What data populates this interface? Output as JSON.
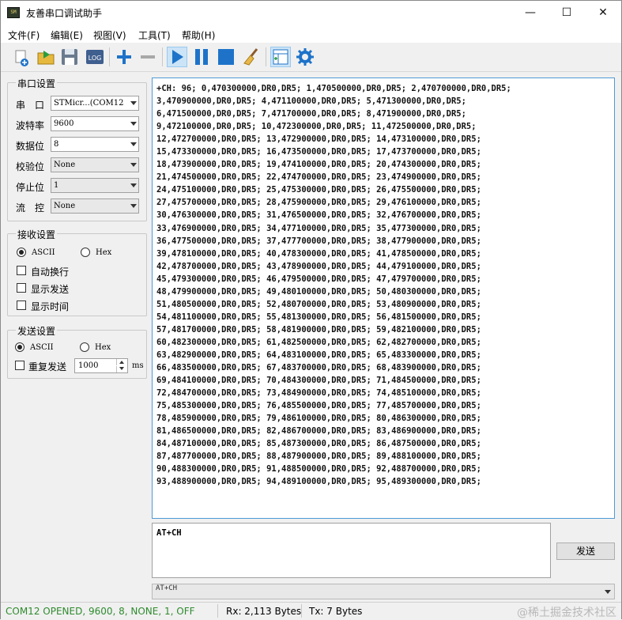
{
  "window": {
    "icon_text": "SM",
    "title": "友善串口调试助手",
    "minimize_glyph": "—",
    "maximize_glyph": "☐",
    "close_glyph": "✕"
  },
  "menu": [
    "文件(F)",
    "编辑(E)",
    "视图(V)",
    "工具(T)",
    "帮助(H)"
  ],
  "toolbar": {
    "log_label": "LOG",
    "icons": [
      "new-icon",
      "open-icon",
      "save-icon",
      "log-icon",
      "add-icon",
      "remove-icon",
      "play-icon",
      "pause-icon",
      "stop-icon",
      "broom-icon",
      "layout-icon",
      "gear-icon"
    ],
    "accent": "#1e73c9"
  },
  "serial_settings": {
    "title": "串口设置",
    "port_label": "串　口",
    "port_value": "STMicr...(COM12",
    "baud_label": "波特率",
    "baud_value": "9600",
    "data_bits_label": "数据位",
    "data_bits_value": "8",
    "parity_label": "校验位",
    "parity_value": "None",
    "stop_bits_label": "停止位",
    "stop_bits_value": "1",
    "flow_label": "流　控",
    "flow_value": "None"
  },
  "receive_settings": {
    "title": "接收设置",
    "ascii_label": "ASCII",
    "hex_label": "Hex",
    "selected": "ASCII",
    "auto_wrap_label": "自动换行",
    "show_send_label": "显示发送",
    "show_time_label": "显示时间"
  },
  "send_settings": {
    "title": "发送设置",
    "ascii_label": "ASCII",
    "hex_label": "Hex",
    "selected": "ASCII",
    "repeat_label": "重复发送",
    "interval_value": "1000",
    "interval_unit": "ms"
  },
  "receive_area": {
    "lines": [
      "+CH: 96; 0,470300000,DR0,DR5; 1,470500000,DR0,DR5; 2,470700000,DR0,DR5;",
      "3,470900000,DR0,DR5; 4,471100000,DR0,DR5; 5,471300000,DR0,DR5;",
      "6,471500000,DR0,DR5; 7,471700000,DR0,DR5; 8,471900000,DR0,DR5;",
      "9,472100000,DR0,DR5; 10,472300000,DR0,DR5; 11,472500000,DR0,DR5;",
      "12,472700000,DR0,DR5; 13,472900000,DR0,DR5; 14,473100000,DR0,DR5;",
      "15,473300000,DR0,DR5; 16,473500000,DR0,DR5; 17,473700000,DR0,DR5;",
      "18,473900000,DR0,DR5; 19,474100000,DR0,DR5; 20,474300000,DR0,DR5;",
      "21,474500000,DR0,DR5; 22,474700000,DR0,DR5; 23,474900000,DR0,DR5;",
      "24,475100000,DR0,DR5; 25,475300000,DR0,DR5; 26,475500000,DR0,DR5;",
      "27,475700000,DR0,DR5; 28,475900000,DR0,DR5; 29,476100000,DR0,DR5;",
      "30,476300000,DR0,DR5; 31,476500000,DR0,DR5; 32,476700000,DR0,DR5;",
      "33,476900000,DR0,DR5; 34,477100000,DR0,DR5; 35,477300000,DR0,DR5;",
      "36,477500000,DR0,DR5; 37,477700000,DR0,DR5; 38,477900000,DR0,DR5;",
      "39,478100000,DR0,DR5; 40,478300000,DR0,DR5; 41,478500000,DR0,DR5;",
      "42,478700000,DR0,DR5; 43,478900000,DR0,DR5; 44,479100000,DR0,DR5;",
      "45,479300000,DR0,DR5; 46,479500000,DR0,DR5; 47,479700000,DR0,DR5;",
      "48,479900000,DR0,DR5; 49,480100000,DR0,DR5; 50,480300000,DR0,DR5;",
      "51,480500000,DR0,DR5; 52,480700000,DR0,DR5; 53,480900000,DR0,DR5;",
      "54,481100000,DR0,DR5; 55,481300000,DR0,DR5; 56,481500000,DR0,DR5;",
      "57,481700000,DR0,DR5; 58,481900000,DR0,DR5; 59,482100000,DR0,DR5;",
      "60,482300000,DR0,DR5; 61,482500000,DR0,DR5; 62,482700000,DR0,DR5;",
      "63,482900000,DR0,DR5; 64,483100000,DR0,DR5; 65,483300000,DR0,DR5;",
      "66,483500000,DR0,DR5; 67,483700000,DR0,DR5; 68,483900000,DR0,DR5;",
      "69,484100000,DR0,DR5; 70,484300000,DR0,DR5; 71,484500000,DR0,DR5;",
      "72,484700000,DR0,DR5; 73,484900000,DR0,DR5; 74,485100000,DR0,DR5;",
      "75,485300000,DR0,DR5; 76,485500000,DR0,DR5; 77,485700000,DR0,DR5;",
      "78,485900000,DR0,DR5; 79,486100000,DR0,DR5; 80,486300000,DR0,DR5;",
      "81,486500000,DR0,DR5; 82,486700000,DR0,DR5; 83,486900000,DR0,DR5;",
      "84,487100000,DR0,DR5; 85,487300000,DR0,DR5; 86,487500000,DR0,DR5;",
      "87,487700000,DR0,DR5; 88,487900000,DR0,DR5; 89,488100000,DR0,DR5;",
      "90,488300000,DR0,DR5; 91,488500000,DR0,DR5; 92,488700000,DR0,DR5;",
      "93,488900000,DR0,DR5; 94,489100000,DR0,DR5; 95,489300000,DR0,DR5;"
    ]
  },
  "send_area": {
    "text": "AT+CH",
    "send_button": "发送",
    "history_value": "AT+CH"
  },
  "statusbar": {
    "connection": "COM12 OPENED, 9600, 8, NONE, 1, OFF",
    "connection_color": "#2e8b2e",
    "rx": "Rx: 2,113 Bytes",
    "tx": "Tx: 7 Bytes",
    "watermark": "@稀土掘金技术社区"
  }
}
